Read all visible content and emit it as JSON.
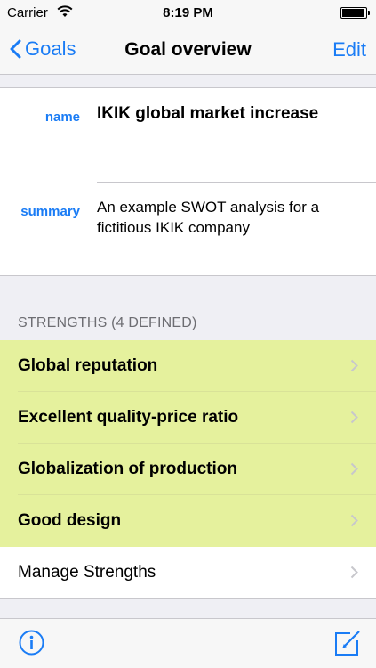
{
  "status_bar": {
    "carrier": "Carrier",
    "time": "8:19 PM"
  },
  "nav": {
    "back_label": "Goals",
    "title": "Goal overview",
    "edit_label": "Edit"
  },
  "goal": {
    "name_label": "name",
    "name_value": "IKIK global market increase",
    "summary_label": "summary",
    "summary_value": "An example SWOT analysis for a fictitious IKIK company"
  },
  "strengths": {
    "header": "STRENGTHS (4 DEFINED)",
    "items": [
      {
        "label": "Global reputation"
      },
      {
        "label": "Excellent quality-price ratio"
      },
      {
        "label": "Globalization of production"
      },
      {
        "label": "Good design"
      }
    ],
    "manage_label": "Manage Strengths"
  },
  "colors": {
    "accent": "#1a7cf5",
    "strength_bg": "#e5f19d",
    "background": "#efeff4"
  },
  "icons": {
    "info": "info-circle-icon",
    "compose": "compose-icon",
    "back": "chevron-left-icon",
    "row": "chevron-right-icon"
  }
}
